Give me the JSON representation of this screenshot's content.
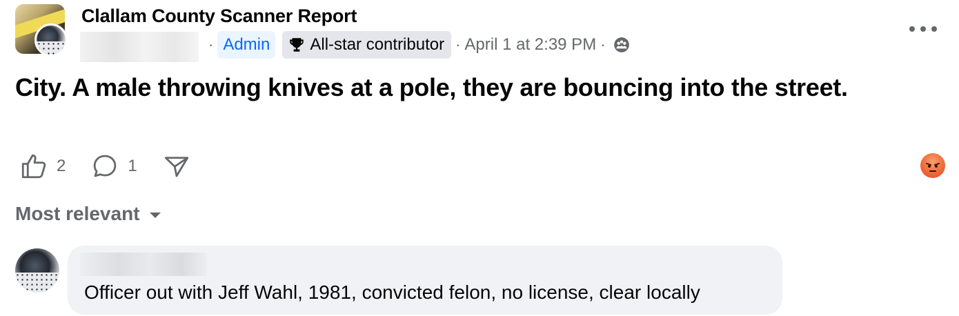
{
  "post": {
    "group_name": "Clallam County Scanner Report",
    "separator": "·",
    "admin_label": "Admin",
    "badge_label": "All-star contributor",
    "timestamp": "April 1 at 2:39 PM",
    "privacy_icon": "group-audience-icon",
    "more_icon": "more-options-icon",
    "body": "City. A male throwing knives at a pole, they are bouncing into the street."
  },
  "actions": {
    "like_count": "2",
    "comment_count": "1",
    "share_icon": "share-icon",
    "reaction_icon": "angry-reaction-icon"
  },
  "comments": {
    "sort_label": "Most relevant",
    "items": [
      {
        "text": "Officer out with Jeff Wahl, 1981, convicted felon, no license, clear locally"
      }
    ]
  },
  "colors": {
    "admin_text": "#0866ff",
    "admin_bg": "#ebf5ff",
    "secondary_text": "#65676b",
    "badge_bg": "#e4e6eb",
    "bubble_bg": "#f0f2f5"
  }
}
